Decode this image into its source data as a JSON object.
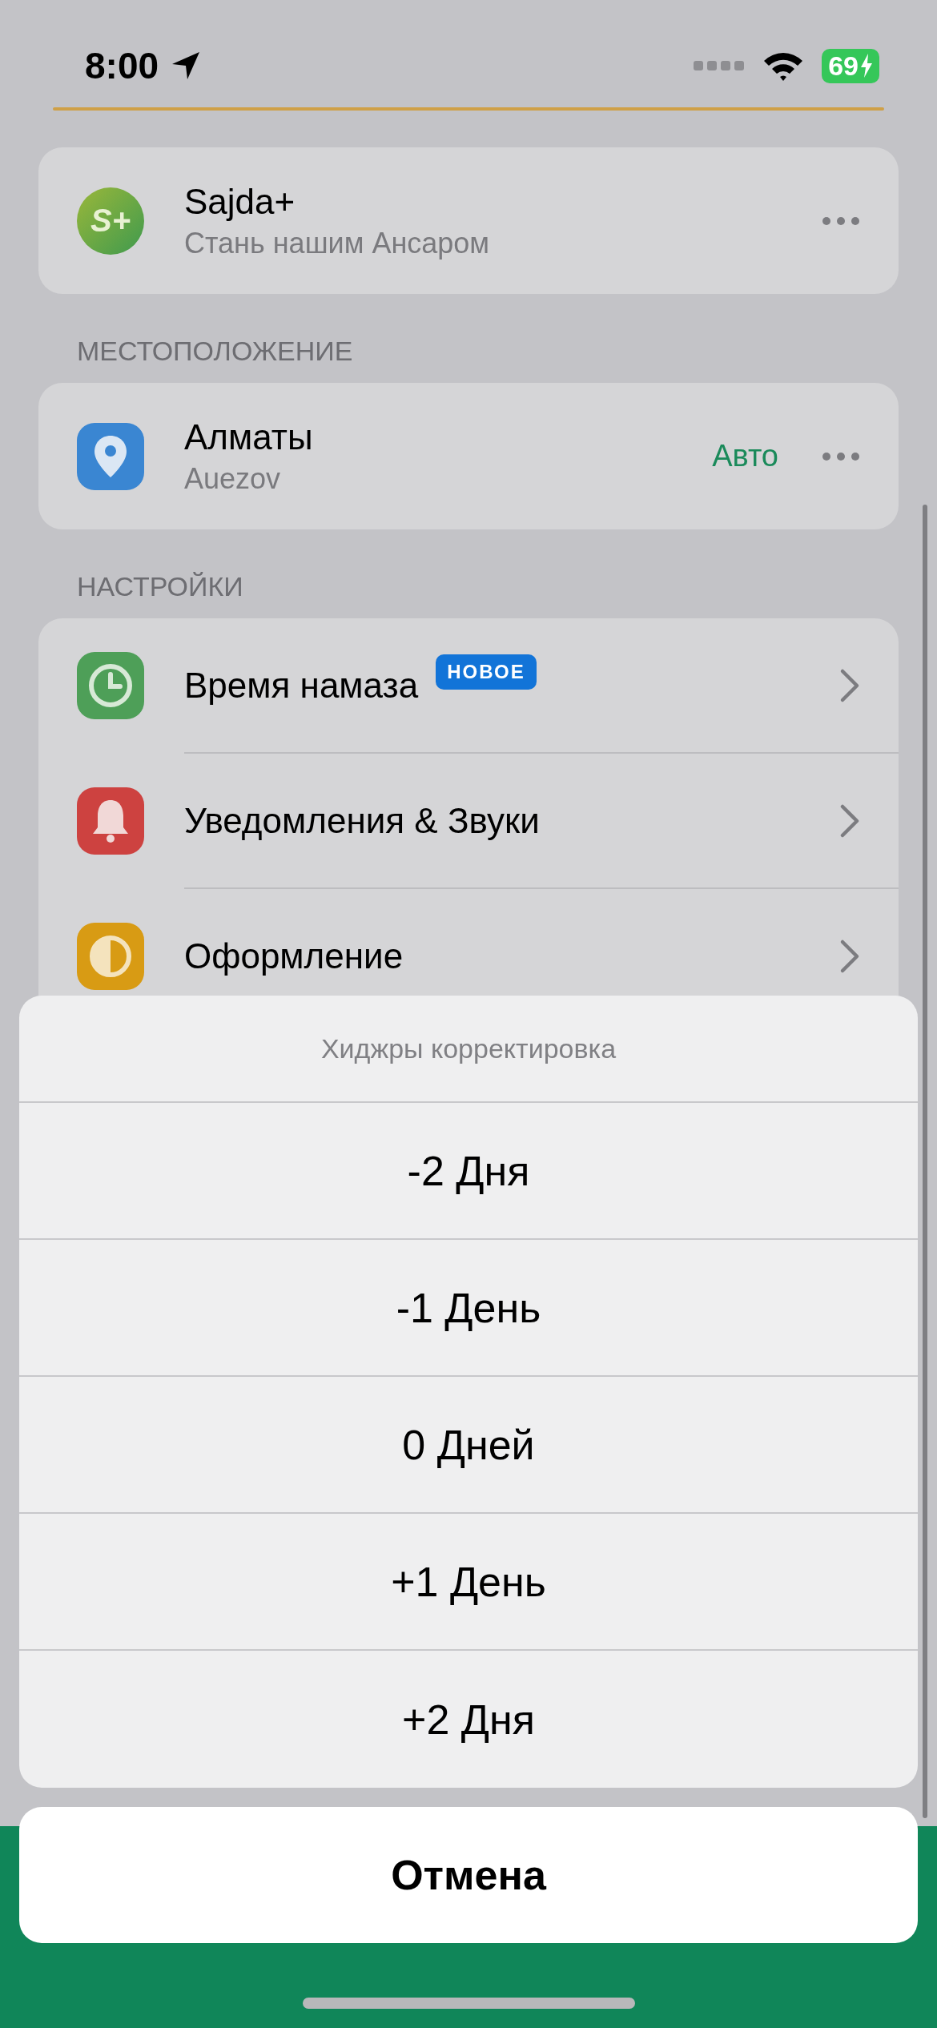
{
  "status_bar": {
    "time": "8:00",
    "battery": "69"
  },
  "promo": {
    "logo": "S+",
    "title": "Sajda+",
    "subtitle": "Стань нашим Ансаром"
  },
  "location": {
    "header": "МЕСТОПОЛОЖЕНИЕ",
    "city": "Алматы",
    "district": "Auezov",
    "mode": "Авто"
  },
  "settings": {
    "header": "НАСТРОЙКИ",
    "items": [
      {
        "kind": "clock",
        "title": "Время намаза",
        "badge": "НОВОЕ"
      },
      {
        "kind": "bell",
        "title": "Уведомления & Звуки"
      },
      {
        "kind": "theme",
        "title": "Оформление"
      }
    ]
  },
  "action_sheet": {
    "title": "Хиджры корректировка",
    "options": [
      "-2 Дня",
      "-1 День",
      "0 Дней",
      "+1 День",
      "+2 Дня"
    ],
    "cancel": "Отмена"
  }
}
